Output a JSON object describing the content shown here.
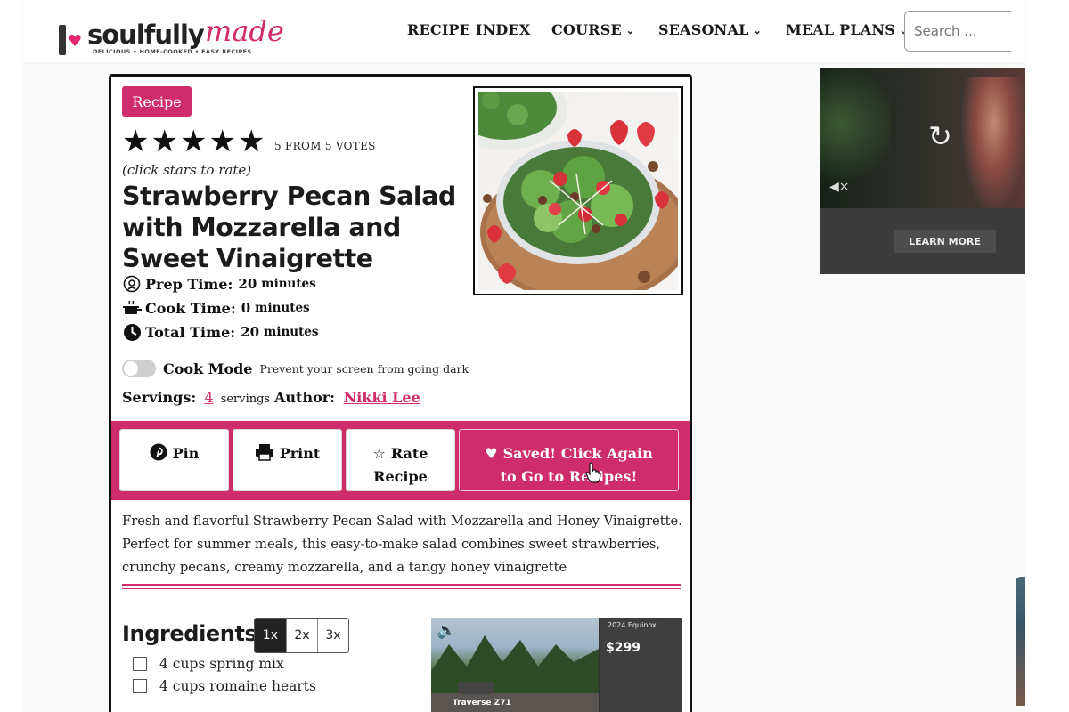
{
  "header": {
    "logo_word1": "soulfully",
    "logo_word2": "made",
    "logo_tagline": "DELICIOUS • HOME-COOKED • EASY RECIPES",
    "nav": [
      {
        "label": "RECIPE INDEX",
        "has_dropdown": false
      },
      {
        "label": "COURSE",
        "has_dropdown": true
      },
      {
        "label": "SEASONAL",
        "has_dropdown": true
      },
      {
        "label": "MEAL PLANS",
        "has_dropdown": true
      }
    ],
    "search_placeholder": "Search ..."
  },
  "recipe": {
    "badge": "Recipe",
    "rating": 5,
    "votes_text": "5 FROM 5 VOTES",
    "rate_hint": "(click stars to rate)",
    "title": "Strawberry Pecan Salad with Mozzarella and Sweet Vinaigrette",
    "prep": {
      "label": "Prep Time:",
      "value": "20",
      "unit": "minutes"
    },
    "cook": {
      "label": "Cook Time:",
      "value": "0",
      "unit": "minutes"
    },
    "total": {
      "label": "Total Time:",
      "value": "20",
      "unit": "minutes"
    },
    "cook_mode": {
      "label": "Cook Mode",
      "description": "Prevent your screen from going dark",
      "enabled": false
    },
    "servings": {
      "label": "Servings:",
      "value": "4",
      "unit": "servings"
    },
    "author": {
      "label": "Author:",
      "name": "Nikki Lee"
    },
    "actions": {
      "pin": "Pin",
      "print": "Print",
      "rate_line1": "Rate",
      "rate_line2": "Recipe",
      "saved_line1": "Saved! Click Again",
      "saved_line2": "to Go to Recipes!"
    },
    "description": "Fresh and flavorful Strawberry Pecan Salad with Mozzarella and Honey Vinaigrette. Perfect for summer meals, this easy-to-make salad combines sweet strawberries, crunchy pecans, creamy mozzarella, and a tangy honey vinaigrette",
    "ingredients_title": "Ingredients",
    "scale": [
      "1x",
      "2x",
      "3x"
    ],
    "ingredients": [
      "4 cups spring mix",
      "4 cups romaine hearts"
    ]
  },
  "ads": {
    "video_cta": "LEARN MORE",
    "inline_brand": "2024 Equinox",
    "inline_price": "$299",
    "inline_model": "Traverse Z71"
  },
  "colors": {
    "accent": "#cf2c6b",
    "text": "#111111"
  }
}
